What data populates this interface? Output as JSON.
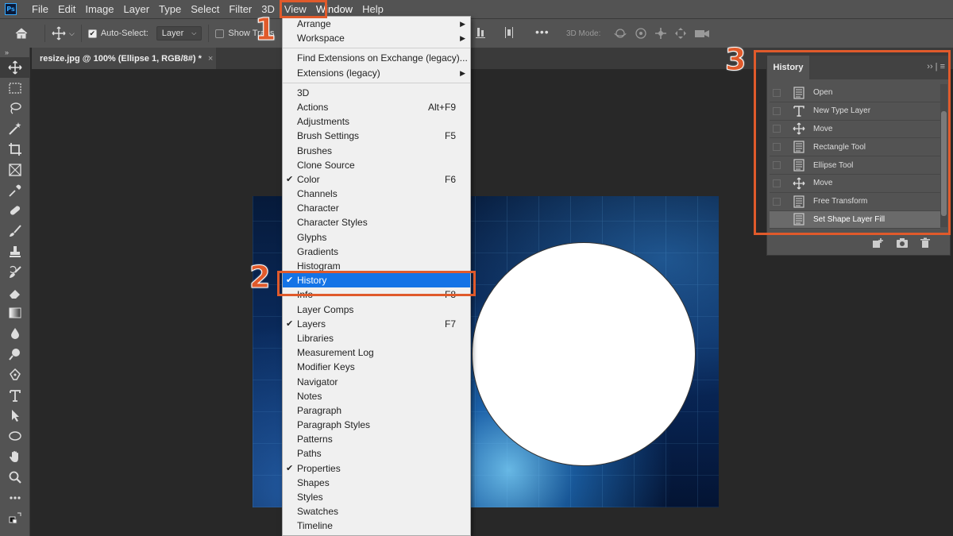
{
  "menubar": {
    "logo": "Ps",
    "items": [
      "File",
      "Edit",
      "Image",
      "Layer",
      "Type",
      "Select",
      "Filter",
      "3D",
      "View",
      "Window",
      "Help"
    ]
  },
  "options_bar": {
    "auto_select_label": "Auto-Select:",
    "layer_select": "Layer",
    "show_transform_label": "Show Trans",
    "three_d_mode_label": "3D Mode:"
  },
  "document_tab": {
    "title": "resize.jpg @ 100% (Ellipse 1, RGB/8#) *",
    "close": "×"
  },
  "toolbar": {
    "tools": [
      "move-tool",
      "marquee-tool",
      "lasso-tool",
      "magic-wand-tool",
      "crop-tool",
      "frame-tool",
      "eyedropper-tool",
      "healing-brush-tool",
      "brush-tool",
      "clone-stamp-tool",
      "history-brush-tool",
      "eraser-tool",
      "gradient-tool",
      "blur-tool",
      "dodge-tool",
      "pen-tool",
      "type-tool",
      "path-selection-tool",
      "ellipse-tool",
      "hand-tool",
      "zoom-tool",
      "more-tools"
    ]
  },
  "window_menu": {
    "groups": [
      [
        {
          "label": "Arrange",
          "submenu": true
        },
        {
          "label": "Workspace",
          "submenu": true
        }
      ],
      [
        {
          "label": "Find Extensions on Exchange (legacy)..."
        },
        {
          "label": "Extensions (legacy)",
          "submenu": true
        }
      ],
      [
        {
          "label": "3D"
        },
        {
          "label": "Actions",
          "shortcut": "Alt+F9"
        },
        {
          "label": "Adjustments"
        },
        {
          "label": "Brush Settings",
          "shortcut": "F5"
        },
        {
          "label": "Brushes"
        },
        {
          "label": "Clone Source"
        },
        {
          "label": "Color",
          "shortcut": "F6",
          "checked": true
        },
        {
          "label": "Channels"
        },
        {
          "label": "Character"
        },
        {
          "label": "Character Styles"
        },
        {
          "label": "Glyphs"
        },
        {
          "label": "Gradients"
        },
        {
          "label": "Histogram"
        },
        {
          "label": "History",
          "checked": true,
          "highlighted": true
        },
        {
          "label": "Info",
          "shortcut": "F8"
        },
        {
          "label": "Layer Comps"
        },
        {
          "label": "Layers",
          "shortcut": "F7",
          "checked": true
        },
        {
          "label": "Libraries"
        },
        {
          "label": "Measurement Log"
        },
        {
          "label": "Modifier Keys"
        },
        {
          "label": "Navigator"
        },
        {
          "label": "Notes"
        },
        {
          "label": "Paragraph"
        },
        {
          "label": "Paragraph Styles"
        },
        {
          "label": "Patterns"
        },
        {
          "label": "Paths"
        },
        {
          "label": "Properties",
          "checked": true
        },
        {
          "label": "Shapes"
        },
        {
          "label": "Styles"
        },
        {
          "label": "Swatches"
        },
        {
          "label": "Timeline"
        }
      ]
    ]
  },
  "history_panel": {
    "title": "History",
    "items": [
      {
        "label": "Open",
        "icon": "document-icon"
      },
      {
        "label": "New Type Layer",
        "icon": "type-icon"
      },
      {
        "label": "Move",
        "icon": "move-icon"
      },
      {
        "label": "Rectangle Tool",
        "icon": "document-icon"
      },
      {
        "label": "Ellipse Tool",
        "icon": "document-icon"
      },
      {
        "label": "Move",
        "icon": "move-icon"
      },
      {
        "label": "Free Transform",
        "icon": "document-icon"
      },
      {
        "label": "Set Shape Layer Fill",
        "icon": "document-icon",
        "current": true
      }
    ]
  },
  "annotations": {
    "step1": "1",
    "step2": "2",
    "step3": "3",
    "color": "#e05a2b"
  }
}
